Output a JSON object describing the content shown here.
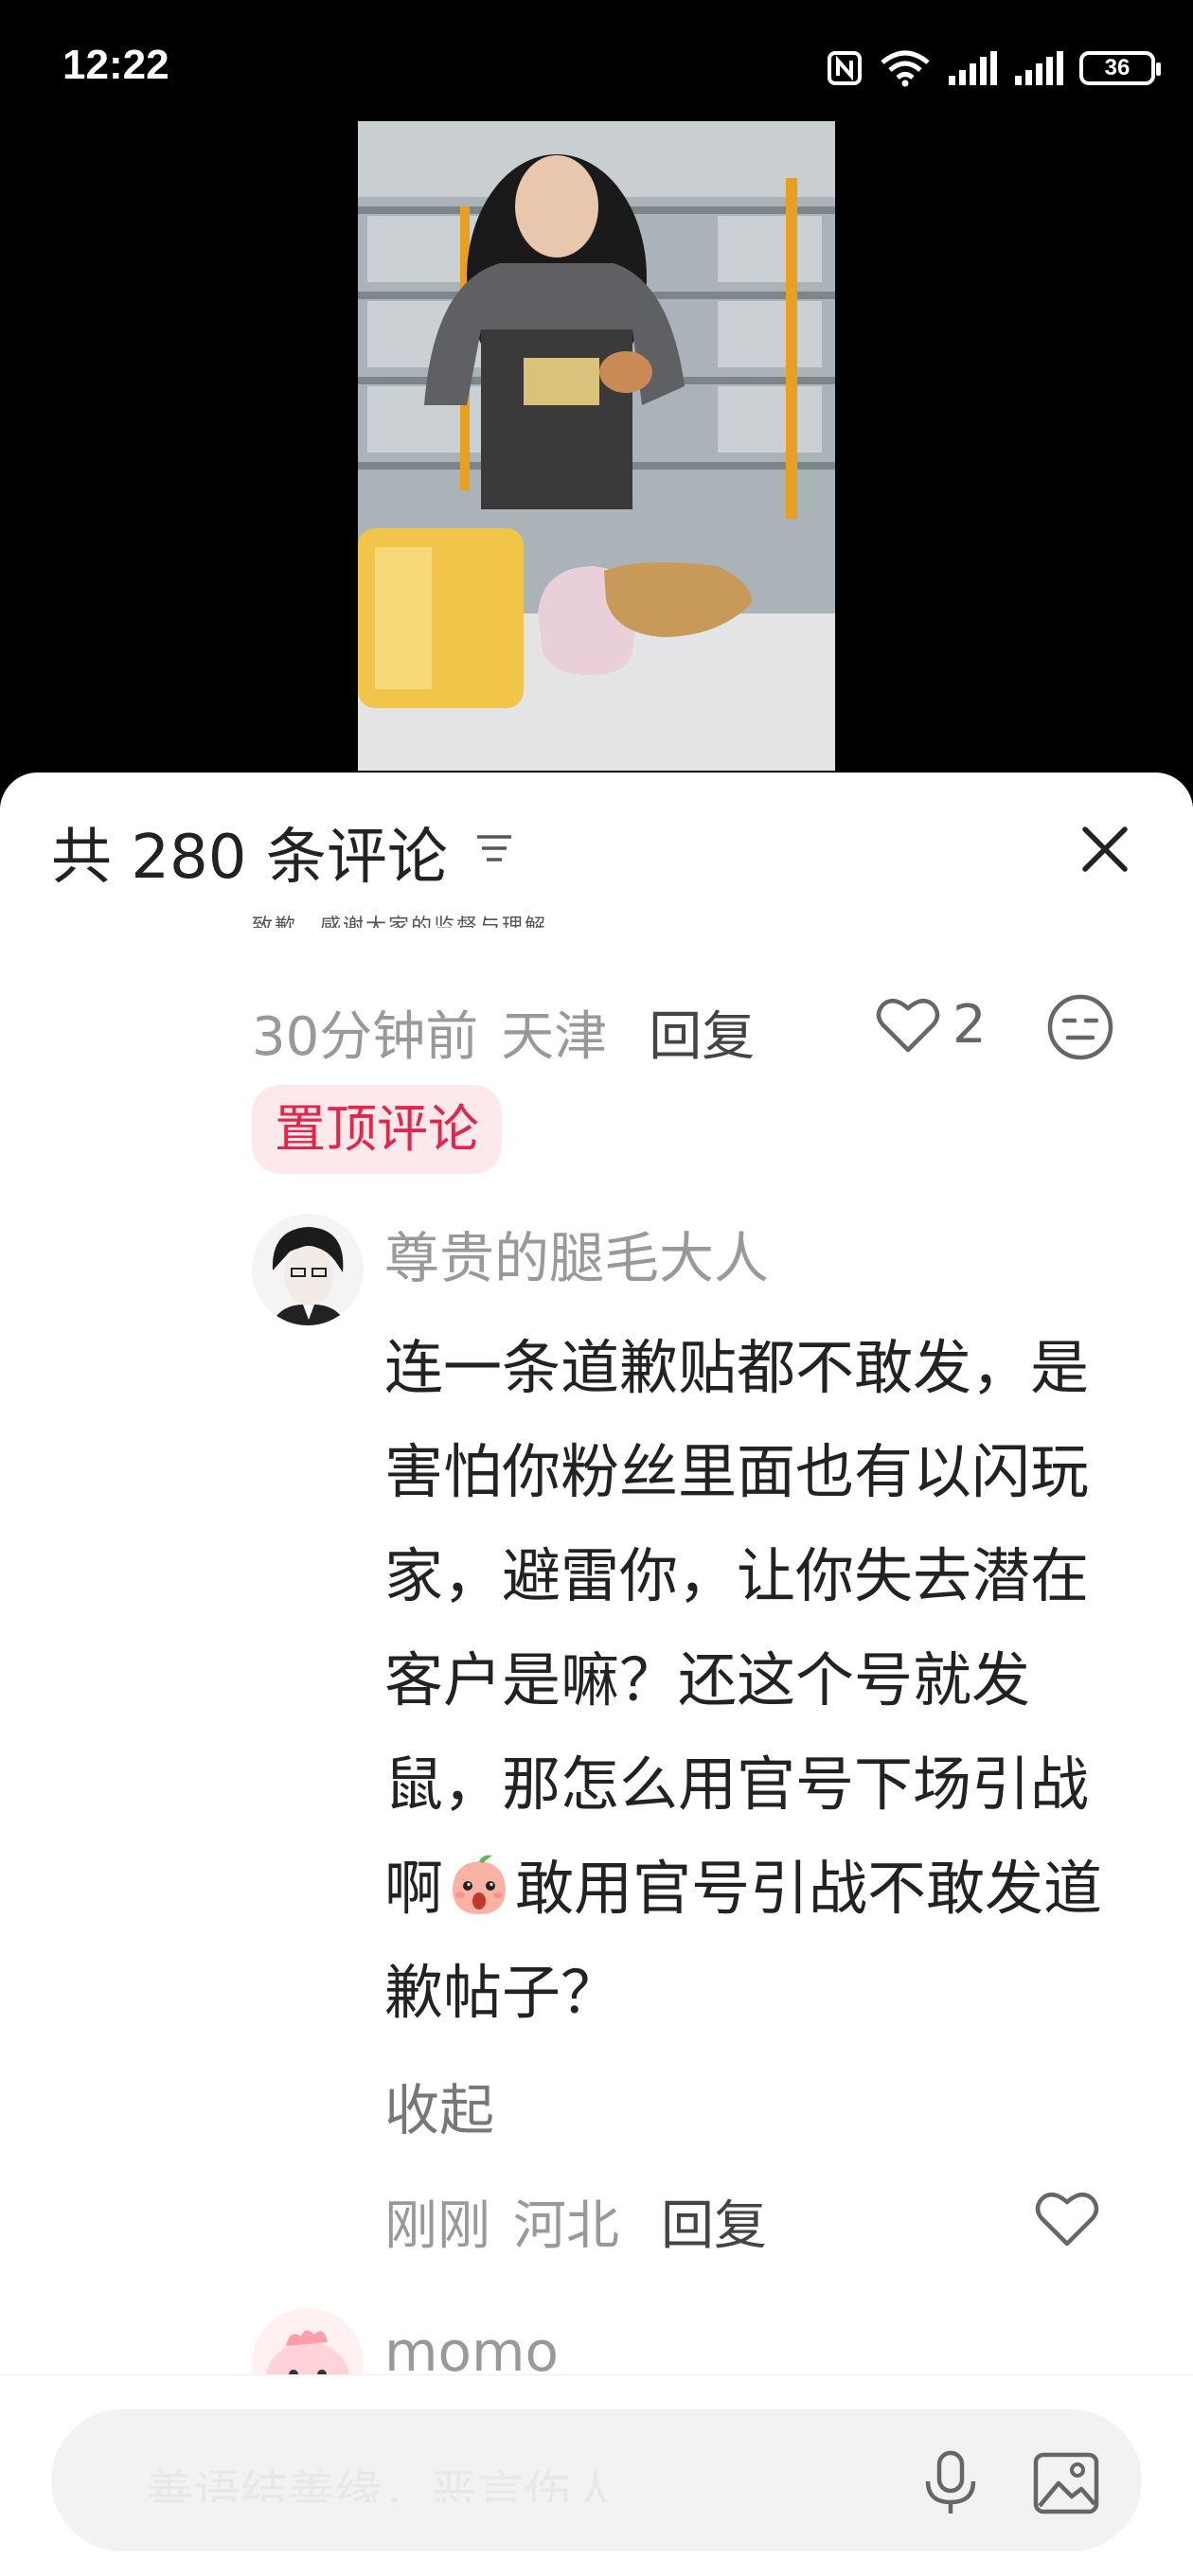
{
  "status_bar": {
    "time": "12:22",
    "battery": "36"
  },
  "comments_panel": {
    "title": "共 280 条评论",
    "clipped_text": "致歉。感谢大家的监督与理解。",
    "pinned_comment": {
      "time": "30分钟前",
      "location": "天津",
      "reply_label": "回复",
      "likes": "2",
      "badge": "置顶评论"
    },
    "comment": {
      "username": "尊贵的腿毛大人",
      "text_before_emoji": "连一条道歉贴都不敢发，是害怕你粉丝里面也有以闪玩家，避雷你，让你失去潜在客户是嘛？还这个号就发鼠，那怎么用官号下场引战啊",
      "text_after_emoji": "敢用官号引战不敢发道歉帖子？",
      "collapse_label": "收起",
      "time": "刚刚",
      "location": "河北",
      "reply_label": "回复"
    },
    "next_comment": {
      "username": "momo"
    }
  },
  "input_bar": {
    "placeholder": "善语结善缘，恶言伤人心"
  },
  "colors": {
    "accent": "#e3254a",
    "badge_bg": "#fde8ec"
  }
}
